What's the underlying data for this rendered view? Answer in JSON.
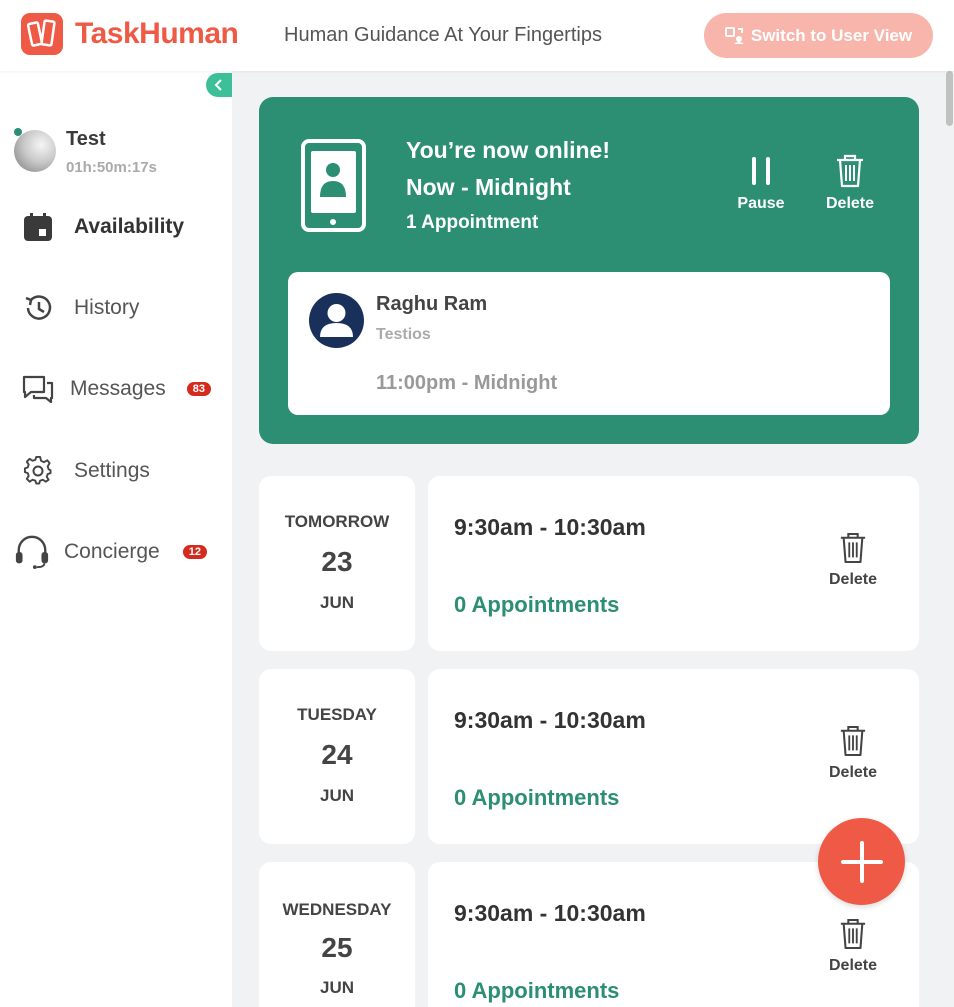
{
  "header": {
    "brand": "TaskHuman",
    "tagline": "Human Guidance At Your Fingertips",
    "switch_label": "Switch to User View"
  },
  "colors": {
    "brand": "#ee5a45",
    "accent_green": "#2c8e73",
    "badge_red": "#d42b1e"
  },
  "sidebar": {
    "profile": {
      "name": "Test",
      "timer": "01h:50m:17s"
    },
    "items": [
      {
        "label": "Availability",
        "icon": "calendar-icon",
        "active": true
      },
      {
        "label": "History",
        "icon": "history-icon"
      },
      {
        "label": "Messages",
        "icon": "chat-icon",
        "badge": "83"
      },
      {
        "label": "Settings",
        "icon": "gear-icon"
      },
      {
        "label": "Concierge",
        "icon": "headset-icon",
        "badge": "12"
      }
    ]
  },
  "online": {
    "title": "You’re now online!",
    "time": "Now - Midnight",
    "appointments": "1 Appointment",
    "pause_label": "Pause",
    "delete_label": "Delete",
    "appointment": {
      "name": "Raghu Ram",
      "subtitle": "Testios",
      "time": "11:00pm - Midnight"
    }
  },
  "slots": [
    {
      "day": "TOMORROW",
      "date": "23",
      "month": "JUN",
      "time": "9:30am - 10:30am",
      "appointments": "0 Appointments",
      "delete_label": "Delete"
    },
    {
      "day": "TUESDAY",
      "date": "24",
      "month": "JUN",
      "time": "9:30am - 10:30am",
      "appointments": "0 Appointments",
      "delete_label": "Delete"
    },
    {
      "day": "WEDNESDAY",
      "date": "25",
      "month": "JUN",
      "time": "9:30am - 10:30am",
      "appointments": "0 Appointments",
      "delete_label": "Delete"
    }
  ]
}
